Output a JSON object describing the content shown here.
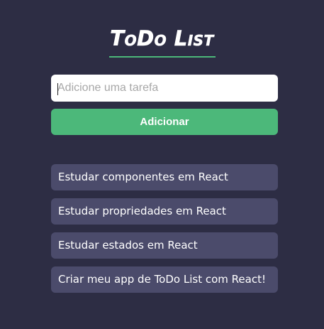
{
  "header": {
    "title": "ToDo List"
  },
  "form": {
    "input_placeholder": "Adicione uma tarefa",
    "input_value": "",
    "add_button_label": "Adicionar"
  },
  "tasks": [
    "Estudar componentes em React",
    "Estudar propriedades em React",
    "Estudar estados em React",
    "Criar meu app de ToDo List com React!"
  ],
  "colors": {
    "background": "#2d2d44",
    "accent": "#4cb87a",
    "task_background": "#4b4b6b",
    "text": "#ffffff"
  }
}
